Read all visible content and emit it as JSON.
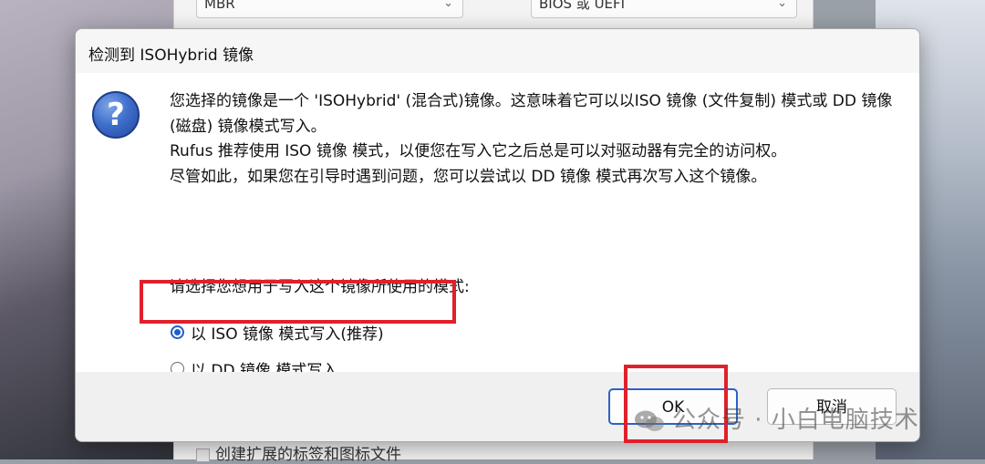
{
  "background": {
    "partition_scheme": "MBR",
    "target_system": "BIOS 或 UEFI",
    "checkbox_label": "创建扩展的标签和图标文件"
  },
  "dialog": {
    "title": "检测到 ISOHybrid 镜像",
    "icon": "question-icon",
    "message_lines": [
      "您选择的镜像是一个 'ISOHybrid' (混合式)镜像。这意味着它可以以ISO 镜像 (文件复制) 模式或 DD 镜像 (磁盘) 镜像模式写入。",
      "Rufus 推荐使用 ISO 镜像 模式，以便您在写入它之后总是可以对驱动器有完全的访问权。",
      "尽管如此，如果您在引导时遇到问题，您可以尝试以 DD 镜像 模式再次写入这个镜像。"
    ],
    "prompt": "请选择您想用于写入这个镜像所使用的模式:",
    "options": [
      {
        "label": "以 ISO 镜像 模式写入(推荐)",
        "selected": true
      },
      {
        "label": "以 DD 镜像 模式写入",
        "selected": false
      }
    ],
    "ok_label": "OK",
    "cancel_label": "取消"
  },
  "watermark": "公众号 · 小白电脑技术",
  "colors": {
    "highlight": "#e0202a",
    "accent": "#1f5fc6"
  }
}
